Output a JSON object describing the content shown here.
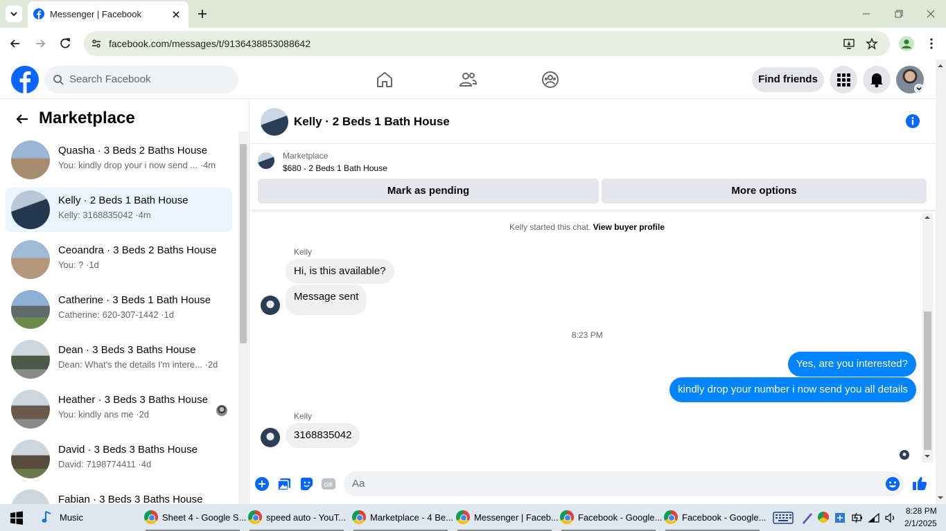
{
  "browser": {
    "tab_title": "Messenger | Facebook",
    "url": "facebook.com/messages/t/9136438853088642"
  },
  "header": {
    "search_placeholder": "Search Facebook",
    "find_friends": "Find friends"
  },
  "sidebar": {
    "title": "Marketplace",
    "conversations": [
      {
        "name": "Quasha · 3 Beds 2 Baths House",
        "snippet": "You: kindly drop your i now send ... ·4m",
        "active": false
      },
      {
        "name": "Kelly · 2 Beds 1 Bath House",
        "snippet": "Kelly: 3168835042 ·4m",
        "active": true
      },
      {
        "name": "Ceoandra · 3 Beds 2 Baths House",
        "snippet": "You: ? ·1d",
        "active": false
      },
      {
        "name": "Catherine · 3 Beds 1 Bath House",
        "snippet": "Catherine: 620-307-1442 ·1d",
        "active": false
      },
      {
        "name": "Dean · 3 Beds 3 Baths House",
        "snippet": "Dean: What's the details I'm intere... ·2d",
        "active": false
      },
      {
        "name": "Heather · 3 Beds 3 Baths House",
        "snippet": "You: kindly ans me ·2d",
        "active": false
      },
      {
        "name": "David · 3 Beds 3 Baths House",
        "snippet": "David: 7198774411 ·4d",
        "active": false
      },
      {
        "name": "Fabian · 3 Beds 3 Baths House",
        "snippet": "",
        "active": false
      }
    ]
  },
  "chat": {
    "title": "Kelly · 2 Beds 1 Bath House",
    "marketplace_label": "Marketplace",
    "listing": "$680 - 2 Beds 1 Bath House",
    "mark_pending": "Mark as pending",
    "more_options": "More options",
    "started_prefix": "Kelly started this chat.",
    "view_profile": "View buyer profile",
    "sender": "Kelly",
    "msg1": "Hi, is this available?",
    "msg2": "Message sent",
    "time": "8:23 PM",
    "out1": "Yes, are you interested?",
    "out2": "kindly drop your number i now send you all details",
    "sender2": "Kelly",
    "msg3": "3168835042",
    "composer_placeholder": "Aa"
  },
  "taskbar": {
    "items": [
      {
        "label": "Music"
      },
      {
        "label": "Sheet 4 - Google S..."
      },
      {
        "label": "speed auto - YouT..."
      },
      {
        "label": "Marketplace - 4 Be..."
      },
      {
        "label": "Messenger | Faceb..."
      },
      {
        "label": "Facebook - Google..."
      },
      {
        "label": "Facebook - Google..."
      }
    ],
    "time": "8:28 PM",
    "date": "2/1/2025"
  },
  "colors": {
    "accent": "#0866ff",
    "bubble_out": "#0084ff",
    "active_row": "#ebf5ff"
  }
}
